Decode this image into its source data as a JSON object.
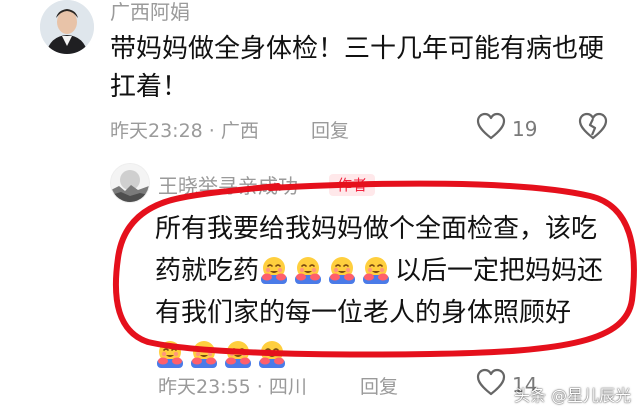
{
  "comment1": {
    "username": "广西阿娟",
    "text": "带妈妈做全身体检！三十几年可能有病也硬扛着！",
    "time_location": "昨天23:28 · 广西",
    "reply_label": "回复",
    "like_count": "19",
    "avatar": "user-photo"
  },
  "comment2": {
    "username": "王晓举寻亲成功",
    "badge": "作者",
    "text_parts": {
      "part1": "所有我要给我妈妈做个全面检查，该吃药就吃药",
      "part2": "以后一定把妈妈还有我们家的每一位老人的身体照顾好"
    },
    "emoji_count_inline": 4,
    "emoji_count_end": 4,
    "emoji": "hugging-face-emoji",
    "time_location": "昨天23:55 · 四川",
    "reply_label": "回复",
    "like_count": "14",
    "avatar": "moon-landscape"
  },
  "highlight": {
    "color": "#e5101c",
    "shape": "hand-drawn-ellipse"
  },
  "watermark": {
    "text": "头条 @星儿辰光"
  },
  "colors": {
    "meta_text": "#9a9a9a",
    "author_badge_bg": "#ffe8ea",
    "author_badge_text": "#f2233f"
  }
}
